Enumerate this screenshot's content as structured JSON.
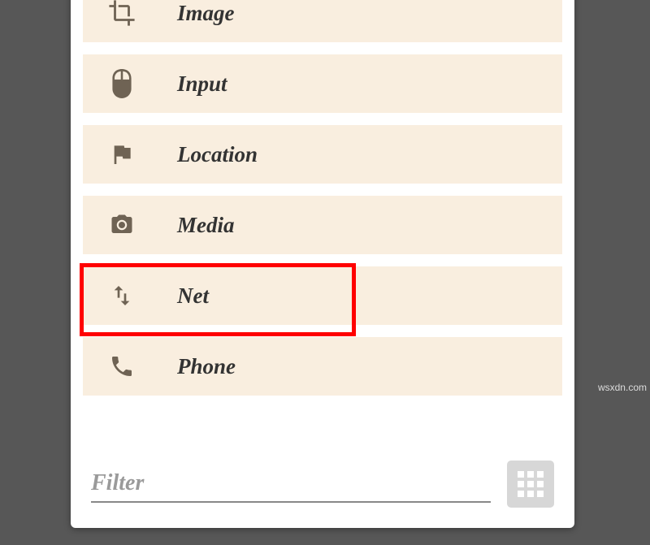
{
  "categories": [
    {
      "id": "image",
      "label": "Image",
      "icon": "crop-icon",
      "highlighted": false
    },
    {
      "id": "input",
      "label": "Input",
      "icon": "mouse-icon",
      "highlighted": false
    },
    {
      "id": "location",
      "label": "Location",
      "icon": "flag-icon",
      "highlighted": false
    },
    {
      "id": "media",
      "label": "Media",
      "icon": "camera-icon",
      "highlighted": false
    },
    {
      "id": "net",
      "label": "Net",
      "icon": "updown-icon",
      "highlighted": true
    },
    {
      "id": "phone",
      "label": "Phone",
      "icon": "phone-icon",
      "highlighted": false
    }
  ],
  "filter": {
    "placeholder": "Filter",
    "value": ""
  },
  "watermark": "wsxdn.com"
}
